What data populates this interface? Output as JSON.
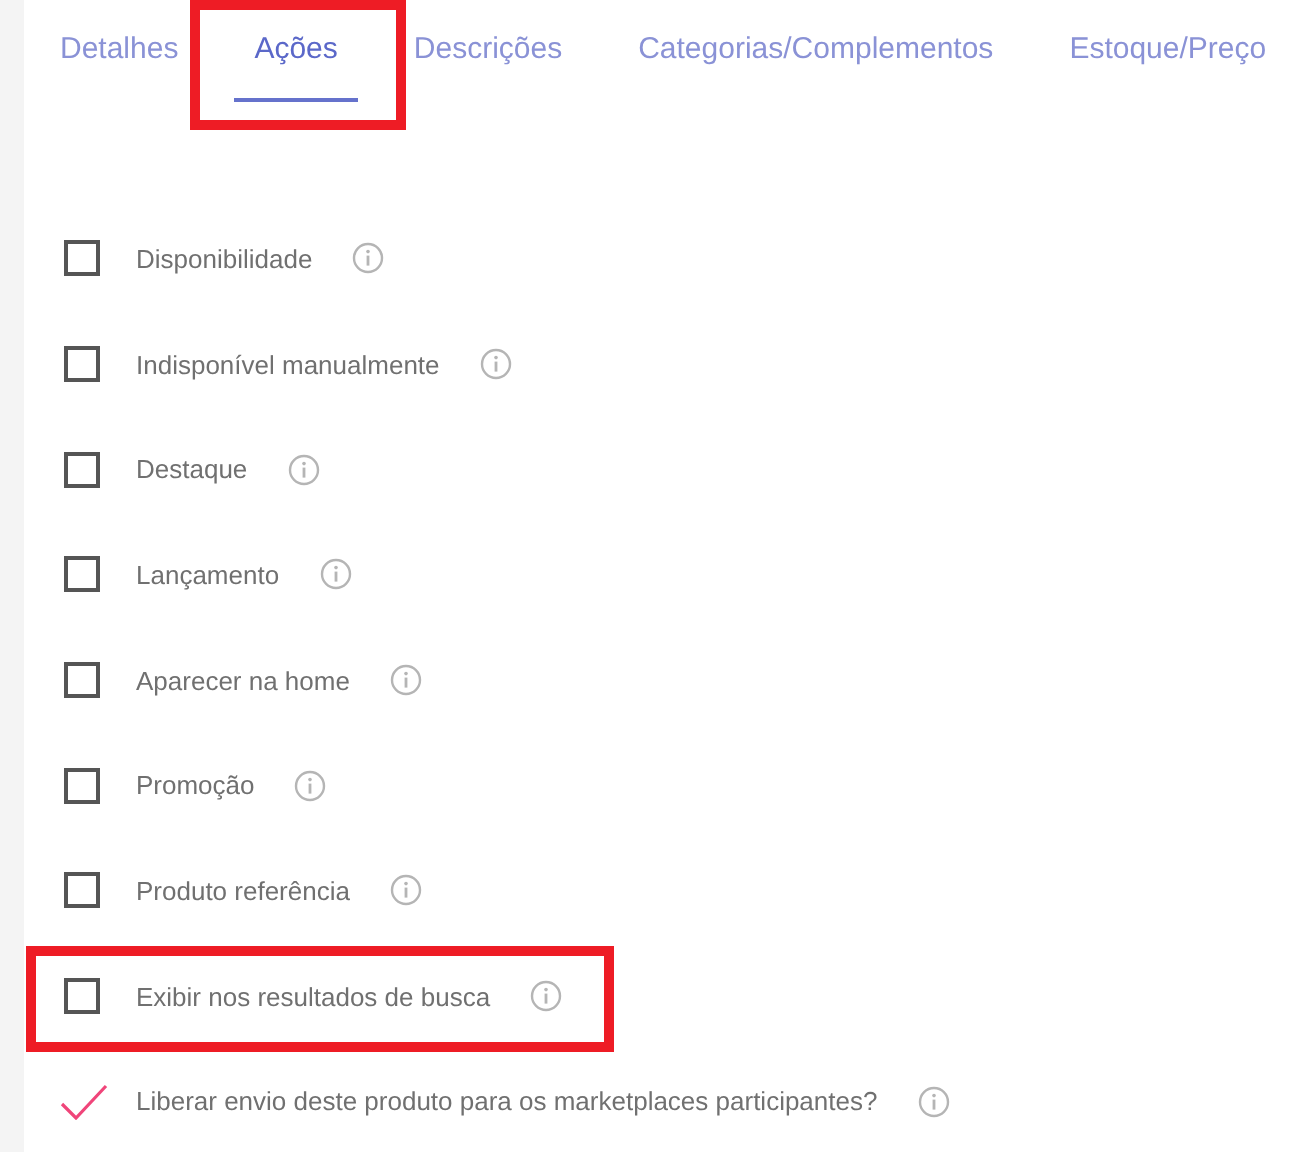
{
  "tabs": [
    {
      "label": "Detalhes",
      "selected": false,
      "highlighted": false
    },
    {
      "label": "Ações",
      "selected": true,
      "highlighted": true
    },
    {
      "label": "Descrições",
      "selected": false,
      "highlighted": false
    },
    {
      "label": "Categorias/Complementos",
      "selected": false,
      "highlighted": false
    },
    {
      "label": "Estoque/Preço",
      "selected": false,
      "highlighted": false
    }
  ],
  "options": [
    {
      "label": "Disponibilidade",
      "checked": false,
      "highlighted": false
    },
    {
      "label": "Indisponível manualmente",
      "checked": false,
      "highlighted": false
    },
    {
      "label": "Destaque",
      "checked": false,
      "highlighted": false
    },
    {
      "label": "Lançamento",
      "checked": false,
      "highlighted": false
    },
    {
      "label": "Aparecer na home",
      "checked": false,
      "highlighted": false
    },
    {
      "label": "Promoção",
      "checked": false,
      "highlighted": false
    },
    {
      "label": "Produto referência",
      "checked": false,
      "highlighted": false
    },
    {
      "label": "Exibir nos resultados de busca",
      "checked": false,
      "highlighted": true
    },
    {
      "label": "Liberar envio deste produto para os marketplaces participantes?",
      "checked": true,
      "highlighted": false
    }
  ]
}
